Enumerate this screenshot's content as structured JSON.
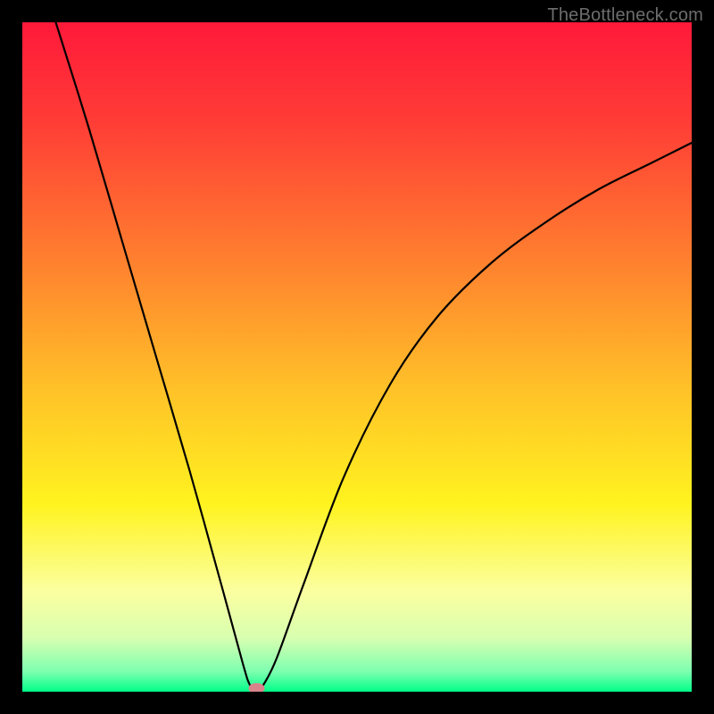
{
  "watermark": "TheBottleneck.com",
  "chart_data": {
    "type": "line",
    "title": "",
    "xlabel": "",
    "ylabel": "",
    "xlim": [
      0,
      100
    ],
    "ylim": [
      0,
      100
    ],
    "grid": false,
    "curve": {
      "x": [
        5,
        10,
        15,
        20,
        25,
        30,
        33,
        34,
        35,
        36,
        38,
        42,
        48,
        55,
        62,
        70,
        78,
        86,
        94,
        100
      ],
      "y": [
        100,
        84,
        67,
        50,
        33,
        15,
        4,
        1,
        0,
        1,
        5,
        16,
        32,
        46,
        56,
        64,
        70,
        75,
        79,
        82
      ]
    },
    "marker": {
      "x": 35,
      "y": 0.5,
      "color": "#d9838b"
    },
    "gradient_stops": [
      {
        "offset": 0.0,
        "color": "#ff193a"
      },
      {
        "offset": 0.15,
        "color": "#ff3d36"
      },
      {
        "offset": 0.35,
        "color": "#ff7e2f"
      },
      {
        "offset": 0.55,
        "color": "#ffc228"
      },
      {
        "offset": 0.72,
        "color": "#fff31f"
      },
      {
        "offset": 0.85,
        "color": "#fbffa0"
      },
      {
        "offset": 0.92,
        "color": "#d8ffb0"
      },
      {
        "offset": 0.97,
        "color": "#7dffb0"
      },
      {
        "offset": 1.0,
        "color": "#00ff88"
      }
    ]
  }
}
